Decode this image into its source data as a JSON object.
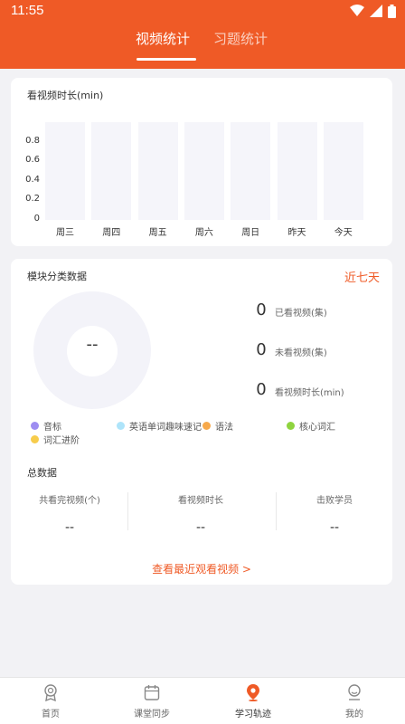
{
  "status": {
    "time": "11:55"
  },
  "tabs": [
    {
      "label": "视频统计",
      "active": true
    },
    {
      "label": "习题统计",
      "active": false
    }
  ],
  "accent_color": "#ef5a26",
  "watch_time_card": {
    "title": "看视频时长(min)"
  },
  "chart_data": {
    "type": "bar",
    "categories": [
      "周三",
      "周四",
      "周五",
      "周六",
      "周日",
      "昨天",
      "今天"
    ],
    "values": [
      0,
      0,
      0,
      0,
      0,
      0,
      0
    ],
    "ylim": [
      0,
      1
    ],
    "yticks": [
      "0",
      "0.2",
      "0.4",
      "0.6",
      "0.8"
    ],
    "grid": false
  },
  "module_card": {
    "title": "模块分类数据",
    "range_link": "近七天",
    "donut_center": "--",
    "stats": [
      {
        "value": "0",
        "label": "已看视频(集)"
      },
      {
        "value": "0",
        "label": "未看视频(集)"
      },
      {
        "value": "0",
        "label": "看视频时长(min)"
      }
    ],
    "legend": [
      {
        "label": "音标",
        "color": "#9d8df1"
      },
      {
        "label": "英语单词趣味速记",
        "color": "#aee4fa"
      },
      {
        "label": "语法",
        "color": "#f7a94b"
      },
      {
        "label": "核心词汇",
        "color": "#8fd43f"
      },
      {
        "label": "词汇进阶",
        "color": "#f7cc4b"
      }
    ],
    "total_title": "总数据",
    "totals": [
      {
        "label": "共看完视频(个)",
        "value": "--"
      },
      {
        "label": "看视频时长",
        "value": "--"
      },
      {
        "label": "击败学员",
        "value": "--"
      }
    ],
    "recent_link": "查看最近观看视频 >"
  },
  "navbar": {
    "items": [
      {
        "label": "首页",
        "icon": "medal-icon",
        "active": false
      },
      {
        "label": "课堂同步",
        "icon": "calendar-icon",
        "active": false
      },
      {
        "label": "学习轨迹",
        "icon": "location-pin-icon",
        "active": true
      },
      {
        "label": "我的",
        "icon": "user-icon",
        "active": false
      }
    ]
  }
}
